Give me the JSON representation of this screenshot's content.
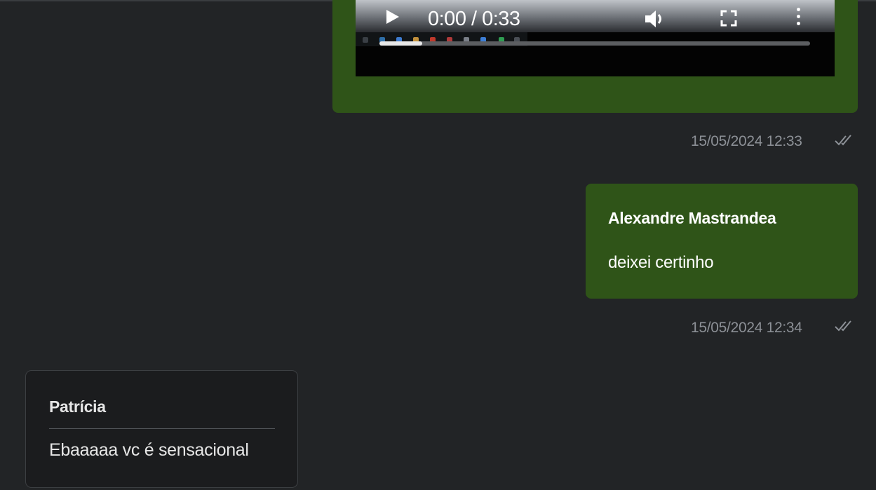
{
  "messages": [
    {
      "type": "video",
      "direction": "outgoing",
      "player": {
        "time_label": "0:00 / 0:33",
        "progress": 0.1,
        "icons": [
          "play-icon",
          "volume-icon",
          "fullscreen-icon",
          "more-vert-icon"
        ]
      },
      "timestamp": "15/05/2024 12:33",
      "status_icon": "double-check-icon"
    },
    {
      "type": "text",
      "direction": "outgoing",
      "sender": "Alexandre Mastrandea",
      "text": "deixei certinho",
      "timestamp": "15/05/2024 12:34",
      "status_icon": "double-check-icon"
    },
    {
      "type": "text",
      "direction": "incoming",
      "sender": "Patrícia",
      "text": "Ebaaaaa vc é sensacional"
    }
  ],
  "colors": {
    "background": "#222426",
    "outgoing_bubble": "#2f5418",
    "incoming_bubble": "#1b1c1e",
    "timestamp_text": "#8c9096"
  }
}
